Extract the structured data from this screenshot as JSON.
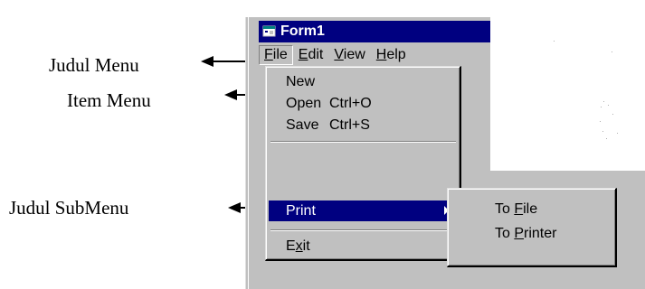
{
  "annotations": {
    "judul_menu": "Judul Menu",
    "item_menu": "Item Menu",
    "judul_submenu": "Judul SubMenu"
  },
  "window": {
    "title": "Form1",
    "app_icon": "form-icon"
  },
  "menubar": {
    "items": [
      {
        "mnemonic": "F",
        "rest": "ile"
      },
      {
        "mnemonic": "E",
        "rest": "dit"
      },
      {
        "mnemonic": "V",
        "rest": "iew"
      },
      {
        "mnemonic": "H",
        "rest": "elp"
      }
    ]
  },
  "file_menu": {
    "new": "New",
    "open": "Open",
    "open_shortcut": "Ctrl+O",
    "save": "Save",
    "save_shortcut": "Ctrl+S",
    "print": "Print",
    "exit_pre": "E",
    "exit_mnemonic": "x",
    "exit_post": "it"
  },
  "print_submenu": {
    "to_file_pre": "To ",
    "to_file_mnemonic": "F",
    "to_file_post": "ile",
    "to_printer_pre": "To ",
    "to_printer_mnemonic": "P",
    "to_printer_post": "rinter"
  },
  "colors": {
    "titlebar": "#000080",
    "menu_face": "#c0c0c0",
    "highlight": "#000080"
  }
}
